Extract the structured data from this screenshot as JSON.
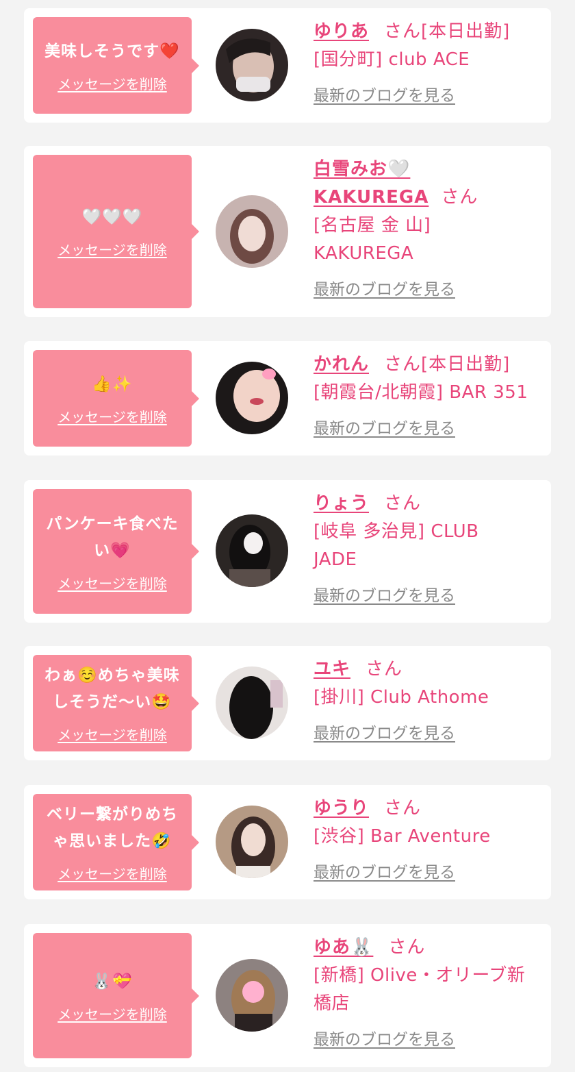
{
  "cards": [
    {
      "message": "美味しそうです❤️",
      "delete_label": "メッセージを削除",
      "name": "ゆりあ",
      "honorific": "さん",
      "status": "[本日出勤]",
      "shop": "[国分町] club ACE",
      "blog_label": "最新のブログを見る",
      "avatar": "avatar-photo"
    },
    {
      "message": "🤍🤍🤍",
      "delete_label": "メッセージを削除",
      "name": "白雪みお🤍 KAKUREGA",
      "honorific": "さん",
      "status": "",
      "shop": "[名古屋 金 山] KAKUREGA",
      "blog_label": "最新のブログを見る",
      "avatar": "avatar-photo"
    },
    {
      "message": "👍✨",
      "delete_label": "メッセージを削除",
      "name": "かれん",
      "honorific": "さん",
      "status": "[本日出勤]",
      "shop": "[朝霞台/北朝霞] BAR 351",
      "blog_label": "最新のブログを見る",
      "avatar": "avatar-photo"
    },
    {
      "message": "パンケーキ食べたい💗",
      "delete_label": "メッセージを削除",
      "name": "りょう",
      "honorific": "さん",
      "status": "",
      "shop": "[岐阜 多治見] CLUB JADE",
      "blog_label": "最新のブログを見る",
      "avatar": "avatar-photo"
    },
    {
      "message": "わぁ☺️めちゃ美味しそうだ〜い🤩",
      "delete_label": "メッセージを削除",
      "name": "ユキ",
      "honorific": "さん",
      "status": "",
      "shop": "[掛川] Club Athome",
      "blog_label": "最新のブログを見る",
      "avatar": "avatar-photo"
    },
    {
      "message": "ベリー繋がりめちゃ思いました🤣",
      "delete_label": "メッセージを削除",
      "name": "ゆうり",
      "honorific": "さん",
      "status": "",
      "shop": "[渋谷] Bar Aventure",
      "blog_label": "最新のブログを見る",
      "avatar": "avatar-photo"
    },
    {
      "message": "🐰💝",
      "delete_label": "メッセージを削除",
      "name": "ゆあ🐰",
      "honorific": "さん",
      "status": "",
      "shop": "[新橋] Olive・オリーブ新橋店",
      "blog_label": "最新のブログを見る",
      "avatar": "avatar-photo"
    }
  ],
  "colors": {
    "accent": "#e8457a",
    "bubble": "#f98d9c",
    "muted_link": "#8a8a8a",
    "background": "#f3f3f3"
  }
}
